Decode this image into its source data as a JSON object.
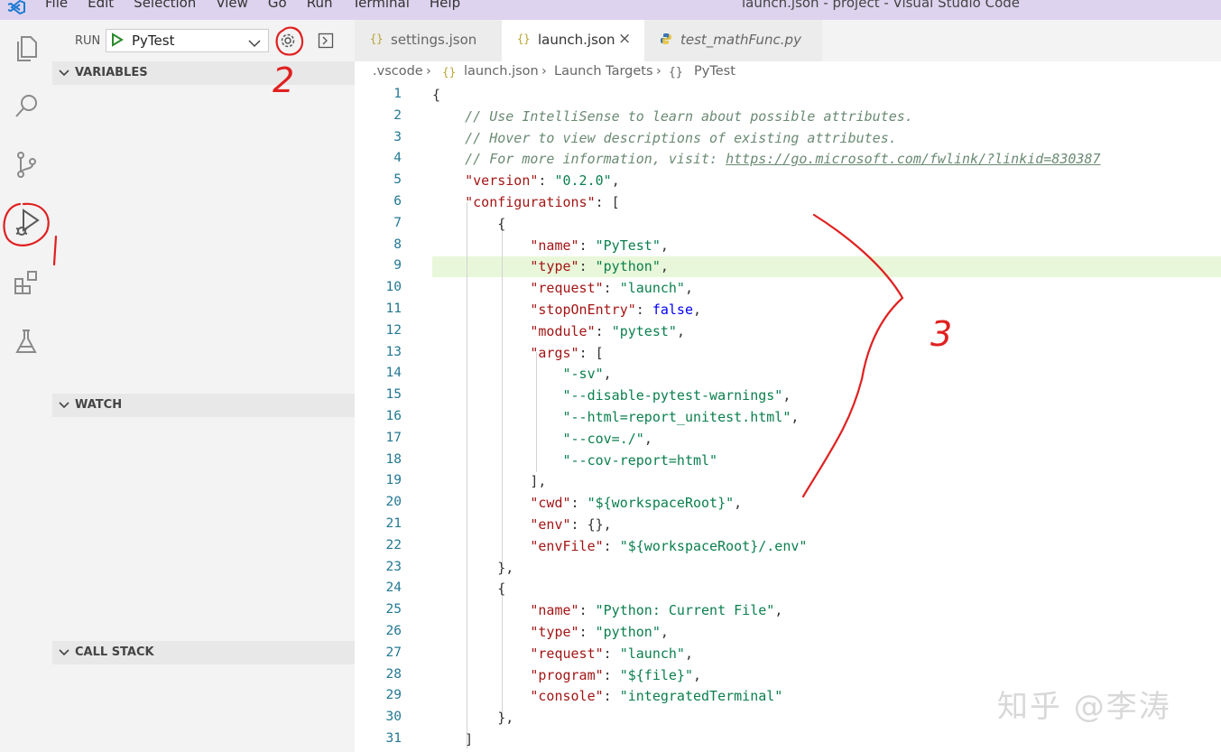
{
  "window": {
    "title": "launch.json - project - Visual Studio Code",
    "menu": [
      "File",
      "Edit",
      "Selection",
      "View",
      "Go",
      "Run",
      "Terminal",
      "Help"
    ]
  },
  "activity_bar": [
    "explorer-icon",
    "search-icon",
    "source-control-icon",
    "run-debug-icon",
    "extensions-icon",
    "testing-icon"
  ],
  "sidebar": {
    "run_label": "RUN",
    "config_selected": "PyTest",
    "sections": [
      "VARIABLES",
      "WATCH",
      "CALL STACK"
    ]
  },
  "tabs": [
    {
      "icon": "{}",
      "label": "settings.json"
    },
    {
      "icon": "{}",
      "label": "launch.json",
      "close": "×"
    },
    {
      "icon": "python-icon",
      "label": "test_mathFunc.py"
    }
  ],
  "breadcrumb": [
    ".vscode",
    "›",
    "{}",
    "launch.json",
    "›",
    "Launch Targets",
    "›",
    "{}",
    "PyTest"
  ],
  "code": {
    "line_numbers": [
      "1",
      "2",
      "3",
      "4",
      "5",
      "6",
      "7",
      "8",
      "9",
      "10",
      "11",
      "12",
      "13",
      "14",
      "15",
      "16",
      "17",
      "18",
      "19",
      "20",
      "21",
      "22",
      "23",
      "24",
      "25",
      "26",
      "27",
      "28",
      "29",
      "30",
      "31"
    ],
    "lines": [
      "{",
      "    // Use IntelliSense to learn about possible attributes.",
      "    // Hover to view descriptions of existing attributes.",
      "    // For more information, visit: https://go.microsoft.com/fwlink/?linkid=830387",
      "    \"version\": \"0.2.0\",",
      "    \"configurations\": [",
      "        {",
      "            \"name\": \"PyTest\",",
      "            \"type\": \"python\",",
      "            \"request\": \"launch\",",
      "            \"stopOnEntry\": false,",
      "            \"module\": \"pytest\",",
      "            \"args\": [",
      "                \"-sv\",",
      "                \"--disable-pytest-warnings\",",
      "                \"--html=report_unitest.html\",",
      "                \"--cov=./\",",
      "                \"--cov-report=html\"",
      "            ],",
      "            \"cwd\": \"${workspaceRoot}\",",
      "            \"env\": {},",
      "            \"envFile\": \"${workspaceRoot}/.env\"",
      "        },",
      "        {",
      "            \"name\": \"Python: Current File\",",
      "            \"type\": \"python\",",
      "            \"request\": \"launch\",",
      "            \"program\": \"${file}\",",
      "            \"console\": \"integratedTerminal\"",
      "        },",
      "    ]"
    ]
  },
  "annotations": {
    "mark_2": "2",
    "mark_3": "3"
  },
  "watermark": "知乎 @李涛",
  "colors": {
    "titlebar": "#ddd3ee",
    "activity": "#f3f3f3",
    "highlight_line": "#e8f7d9",
    "annotation": "#e02020"
  }
}
